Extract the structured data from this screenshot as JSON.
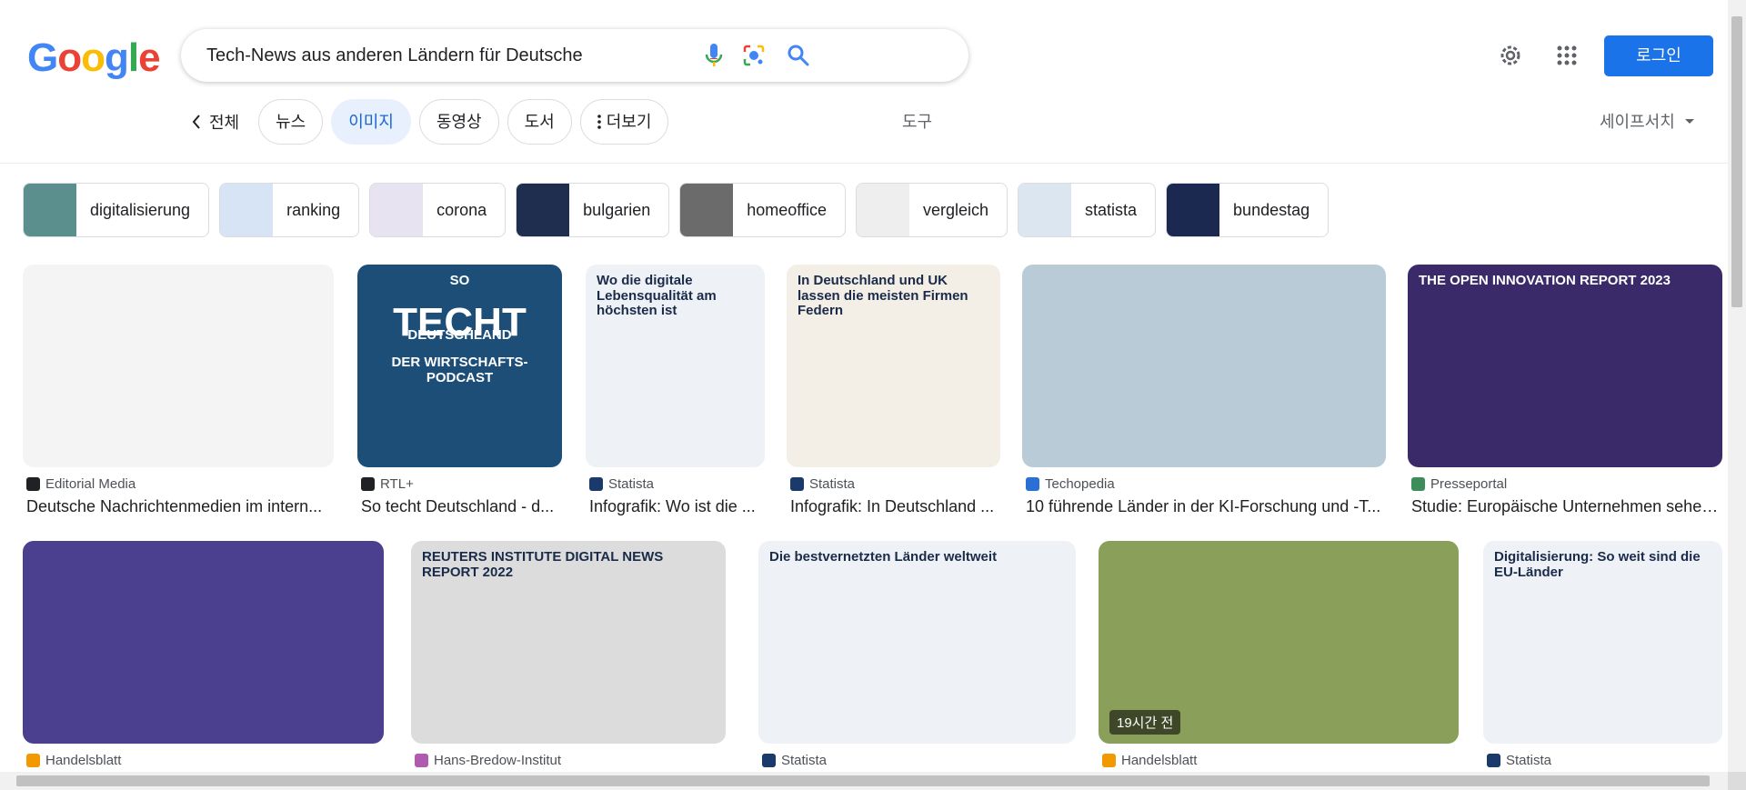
{
  "logo": {
    "letters": [
      "G",
      "o",
      "o",
      "g",
      "l",
      "e"
    ],
    "colors": [
      "#4285f4",
      "#ea4335",
      "#fbbc05",
      "#4285f4",
      "#34a853",
      "#ea4335"
    ]
  },
  "search": {
    "query": "Tech-News aus anderen Ländern für Deutsche",
    "icons": [
      "microphone-icon",
      "lens-icon",
      "search-icon"
    ]
  },
  "header": {
    "settings_icon": "gear-icon",
    "apps_icon": "apps-grid-icon",
    "login_label": "로그인"
  },
  "tabs": [
    {
      "label": "전체",
      "active": false
    },
    {
      "label": "뉴스",
      "active": false
    },
    {
      "label": "이미지",
      "active": true
    },
    {
      "label": "동영상",
      "active": false
    },
    {
      "label": "도서",
      "active": false
    },
    {
      "label": "더보기",
      "active": false
    }
  ],
  "tools_label": "도구",
  "safesearch_label": "세이프서치",
  "chips": [
    {
      "label": "digitalisierung",
      "color": "#5a8f8e"
    },
    {
      "label": "ranking",
      "color": "#d6e4f5"
    },
    {
      "label": "corona",
      "color": "#e7e3f0"
    },
    {
      "label": "bulgarien",
      "color": "#1f2d4f"
    },
    {
      "label": "homeoffice",
      "color": "#6b6b6b"
    },
    {
      "label": "vergleich",
      "color": "#eeeeee"
    },
    {
      "label": "statista",
      "color": "#dce6f0"
    },
    {
      "label": "bundestag",
      "color": "#1b2850"
    }
  ],
  "results_row1": [
    {
      "source": "Editorial Media",
      "title": "Deutsche Nachrichtenmedien im intern...",
      "bg": "#f4f4f4",
      "fav": "#202124"
    },
    {
      "source": "RTL+",
      "title": "So techt Deutschland - d...",
      "bg": "#1c4e78",
      "fav": "#202124",
      "overlay": [
        "SO",
        "TECHT",
        "DEUTSCHLAND",
        "DER WIRTSCHAFTS-PODCAST"
      ]
    },
    {
      "source": "Statista",
      "title": "Infografik: Wo ist die ...",
      "bg": "#eef2f7",
      "fav": "#1a3a6b",
      "overlay": [
        "Wo die digitale Lebensqualität am höchsten ist"
      ]
    },
    {
      "source": "Statista",
      "title": "Infografik: In Deutschland ...",
      "bg": "#f3eee6",
      "fav": "#1a3a6b",
      "overlay": [
        "In Deutschland und UK lassen die meisten Firmen Federn"
      ]
    },
    {
      "source": "Techopedia",
      "title": "10 führende Länder in der KI-Forschung und -T...",
      "bg": "#b9cbd7",
      "fav": "#2a6fd6"
    },
    {
      "source": "Presseportal",
      "title": "Studie: Europäische Unternehmen sehen...",
      "bg": "#3a2a6a",
      "fav": "#3b8e5a",
      "overlay": [
        "THE OPEN INNOVATION REPORT 2023"
      ]
    }
  ],
  "results_row2": [
    {
      "source": "Handelsblatt",
      "bg": "#4b3f8f",
      "fav": "#f29900"
    },
    {
      "source": "Hans-Bredow-Institut",
      "bg": "#dcdcdc",
      "fav": "#b05ab0",
      "overlay": [
        "REUTERS INSTITUTE DIGITAL NEWS REPORT 2022"
      ]
    },
    {
      "source": "Statista",
      "bg": "#eef2f7",
      "fav": "#1a3a6b",
      "overlay": [
        "Die bestvernetzten Länder weltweit"
      ]
    },
    {
      "source": "Handelsblatt",
      "bg": "#8aa05a",
      "fav": "#f29900",
      "badge": "19시간 전"
    },
    {
      "source": "Statista",
      "bg": "#eef2f7",
      "fav": "#1a3a6b",
      "overlay": [
        "Digitalisierung: So weit sind die EU-Länder"
      ]
    }
  ]
}
